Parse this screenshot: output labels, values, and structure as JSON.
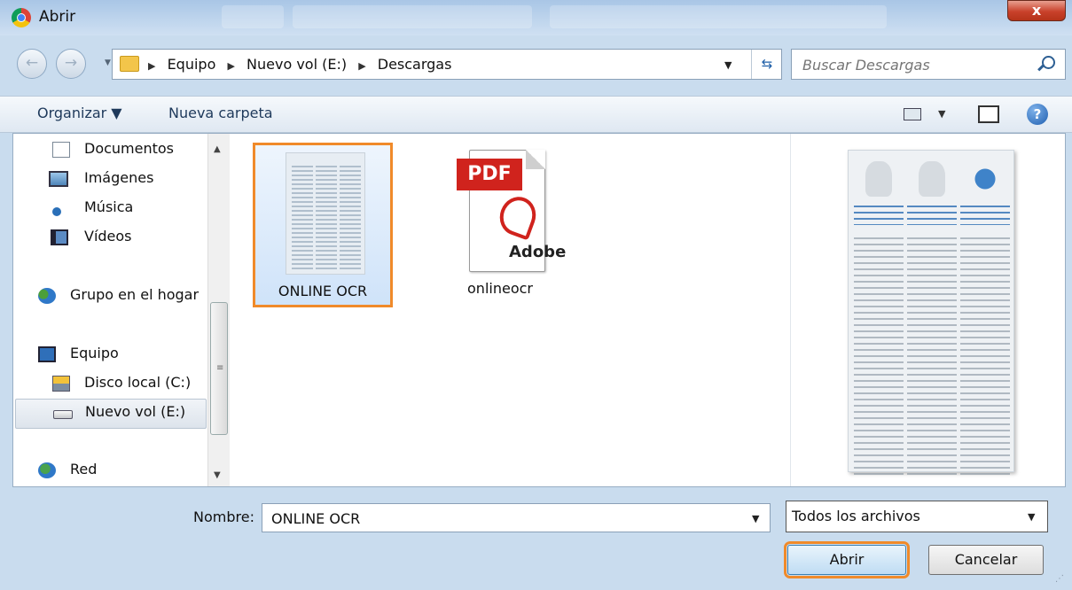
{
  "window": {
    "title": "Abrir",
    "close_glyph": "x"
  },
  "nav": {
    "back_glyph": "←",
    "forward_glyph": "→",
    "history_glyph": "▼"
  },
  "address": {
    "crumbs": [
      "Equipo",
      "Nuevo vol (E:)",
      "Descargas"
    ],
    "separator": "▶",
    "dropdown_glyph": "▼",
    "refresh_glyph": "⇆"
  },
  "search": {
    "placeholder": "Buscar Descargas"
  },
  "toolbar": {
    "organize": "Organizar ▼",
    "new_folder": "Nueva carpeta",
    "view_drop": "▼",
    "help": "?"
  },
  "sidebar": {
    "items": [
      {
        "label": "Documentos",
        "icon": "documents-icon"
      },
      {
        "label": "Imágenes",
        "icon": "pictures-icon"
      },
      {
        "label": "Música",
        "icon": "music-icon"
      },
      {
        "label": "Vídeos",
        "icon": "videos-icon"
      },
      {
        "label": "Grupo en el hogar",
        "icon": "homegroup-icon"
      },
      {
        "label": "Equipo",
        "icon": "computer-icon"
      },
      {
        "label": "Disco local (C:)",
        "icon": "local-disk-icon"
      },
      {
        "label": "Nuevo vol (E:)",
        "icon": "drive-icon"
      },
      {
        "label": "Red",
        "icon": "network-icon"
      }
    ],
    "selected_index": 7,
    "scroll_up": "▲",
    "scroll_down": "▼",
    "scroll_grip": "≡"
  },
  "files": [
    {
      "name": "ONLINE OCR",
      "icon": "document-thumbnail-icon",
      "selected": true
    },
    {
      "name": "onlineocr",
      "icon": "pdf-icon",
      "selected": false
    }
  ],
  "pdf_icon": {
    "tag": "PDF",
    "brand": "Adobe"
  },
  "bottom": {
    "name_label": "Nombre:",
    "name_value": "ONLINE OCR",
    "name_drop": "▼",
    "filter_value": "Todos los archivos",
    "filter_drop": "▼",
    "open_button": "Abrir",
    "cancel_button": "Cancelar",
    "resize_grip": "⋰"
  },
  "colors": {
    "highlight": "#f08a2a",
    "title_bar": "#b9d1ea",
    "pdf_red": "#d0231d"
  }
}
